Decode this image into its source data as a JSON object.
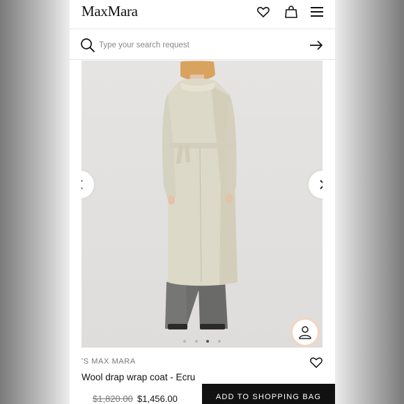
{
  "header": {
    "logo": "MaxMara",
    "icons": [
      "heart-icon",
      "shopping-bag-icon",
      "menu-icon"
    ]
  },
  "search": {
    "placeholder": "Type your search request",
    "icon": "search-icon",
    "submit_icon": "arrow-right-icon"
  },
  "gallery": {
    "slide_count": 4,
    "active_slide": 3,
    "prev_icon": "chevron-left-icon",
    "next_icon": "chevron-right-icon",
    "try_on_icon": "person-icon"
  },
  "product": {
    "brand": "'S MAX MARA",
    "name": "Wool drap wrap coat - Ecru",
    "original_price": "$1,820.00",
    "sale_price": "$1,456.00",
    "add_to_bag_label": "ADD TO SHOPPING BAG",
    "wishlist_icon": "heart-icon"
  },
  "colors": {
    "accent": "#111111",
    "coat": "#ddd9c8",
    "background": "#e6e4e2"
  }
}
